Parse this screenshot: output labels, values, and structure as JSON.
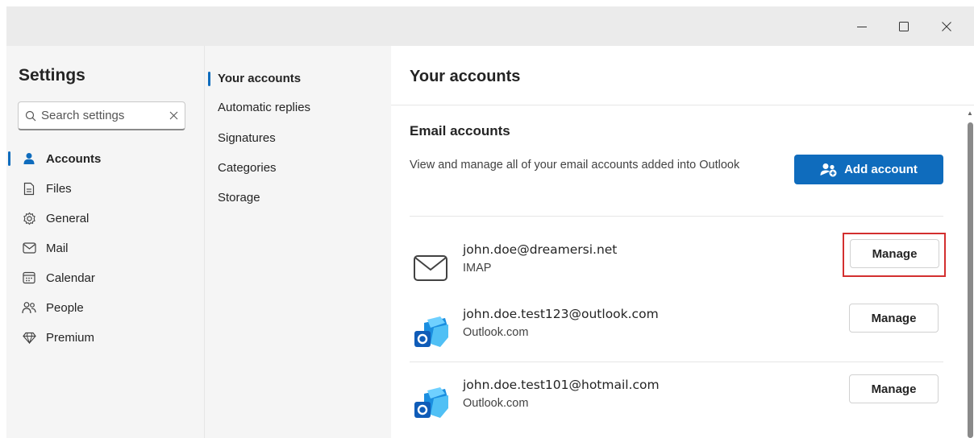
{
  "window": {
    "minimize_icon": "minimize-icon",
    "maximize_icon": "maximize-icon",
    "close_icon": "close-icon"
  },
  "sidebar": {
    "title": "Settings",
    "search": {
      "placeholder": "Search settings",
      "value": ""
    },
    "items": [
      {
        "label": "Accounts",
        "icon": "person-icon",
        "active": true
      },
      {
        "label": "Files",
        "icon": "document-icon"
      },
      {
        "label": "General",
        "icon": "gear-icon"
      },
      {
        "label": "Mail",
        "icon": "mail-icon"
      },
      {
        "label": "Calendar",
        "icon": "calendar-icon"
      },
      {
        "label": "People",
        "icon": "people-icon"
      },
      {
        "label": "Premium",
        "icon": "diamond-icon"
      }
    ]
  },
  "subnav": {
    "items": [
      {
        "label": "Your accounts",
        "active": true
      },
      {
        "label": "Automatic replies"
      },
      {
        "label": "Signatures"
      },
      {
        "label": "Categories"
      },
      {
        "label": "Storage"
      }
    ]
  },
  "main": {
    "title": "Your accounts",
    "section_title": "Email accounts",
    "section_desc": "View and manage all of your email accounts added into Outlook",
    "add_button_label": "Add account",
    "accounts": [
      {
        "email": "john.doe@dreamersi.net",
        "type": "IMAP",
        "icon": "envelope-icon",
        "button": "Manage",
        "highlighted": true
      },
      {
        "email": "john.doe.test123@outlook.com",
        "type": "Outlook.com",
        "icon": "outlook-logo-icon",
        "button": "Manage"
      },
      {
        "email": "john.doe.test101@hotmail.com",
        "type": "Outlook.com",
        "icon": "outlook-logo-icon",
        "button": "Manage"
      }
    ]
  },
  "colors": {
    "accent": "#0f6cbd",
    "highlight": "#d32f2f",
    "pane_bg": "#f5f5f5"
  }
}
